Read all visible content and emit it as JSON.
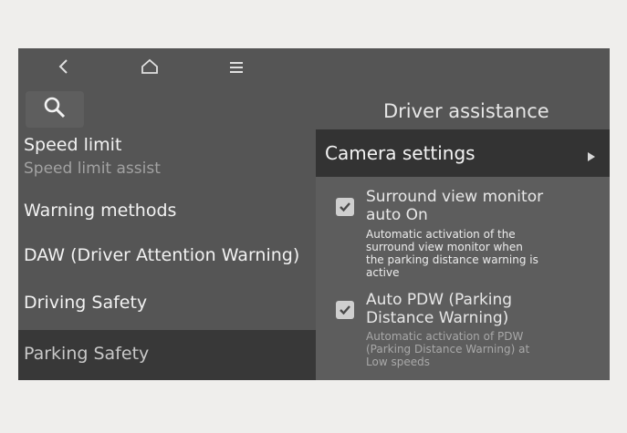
{
  "nav": {
    "back_icon": "chevron-left-icon",
    "home_icon": "home-icon",
    "menu_icon": "hamburger-menu-icon"
  },
  "search": {
    "icon": "search-icon"
  },
  "page_title": "Driver assistance",
  "menu": {
    "speed_limit": {
      "label": "Speed limit",
      "sub": "Speed limit assist"
    },
    "warning_methods": "Warning methods",
    "daw": "DAW (Driver Attention Warning)",
    "driving_safety": "Driving Safety",
    "parking_safety": "Parking Safety"
  },
  "camera": {
    "label": "Camera settings",
    "arrow_icon": "triangle-right-icon"
  },
  "options": {
    "svm": {
      "title_line1": "Surround view monitor",
      "title_line2": "auto On",
      "checked": true,
      "desc_line1": "Automatic activation of the",
      "desc_line2": "surround view monitor when",
      "desc_line3": "the parking distance warning is",
      "desc_line4": "active"
    },
    "pdw": {
      "title_line1": "Auto PDW (Parking",
      "title_line2": "Distance Warning)",
      "checked": true,
      "desc_line1": "Automatic activation of PDW",
      "desc_line2": "(Parking Distance Warning) at",
      "desc_line3": "Low speeds"
    }
  },
  "colors": {
    "background": "#555555",
    "selected": "#383838",
    "panel": "#5d5d5d",
    "camera_row": "#333333"
  }
}
